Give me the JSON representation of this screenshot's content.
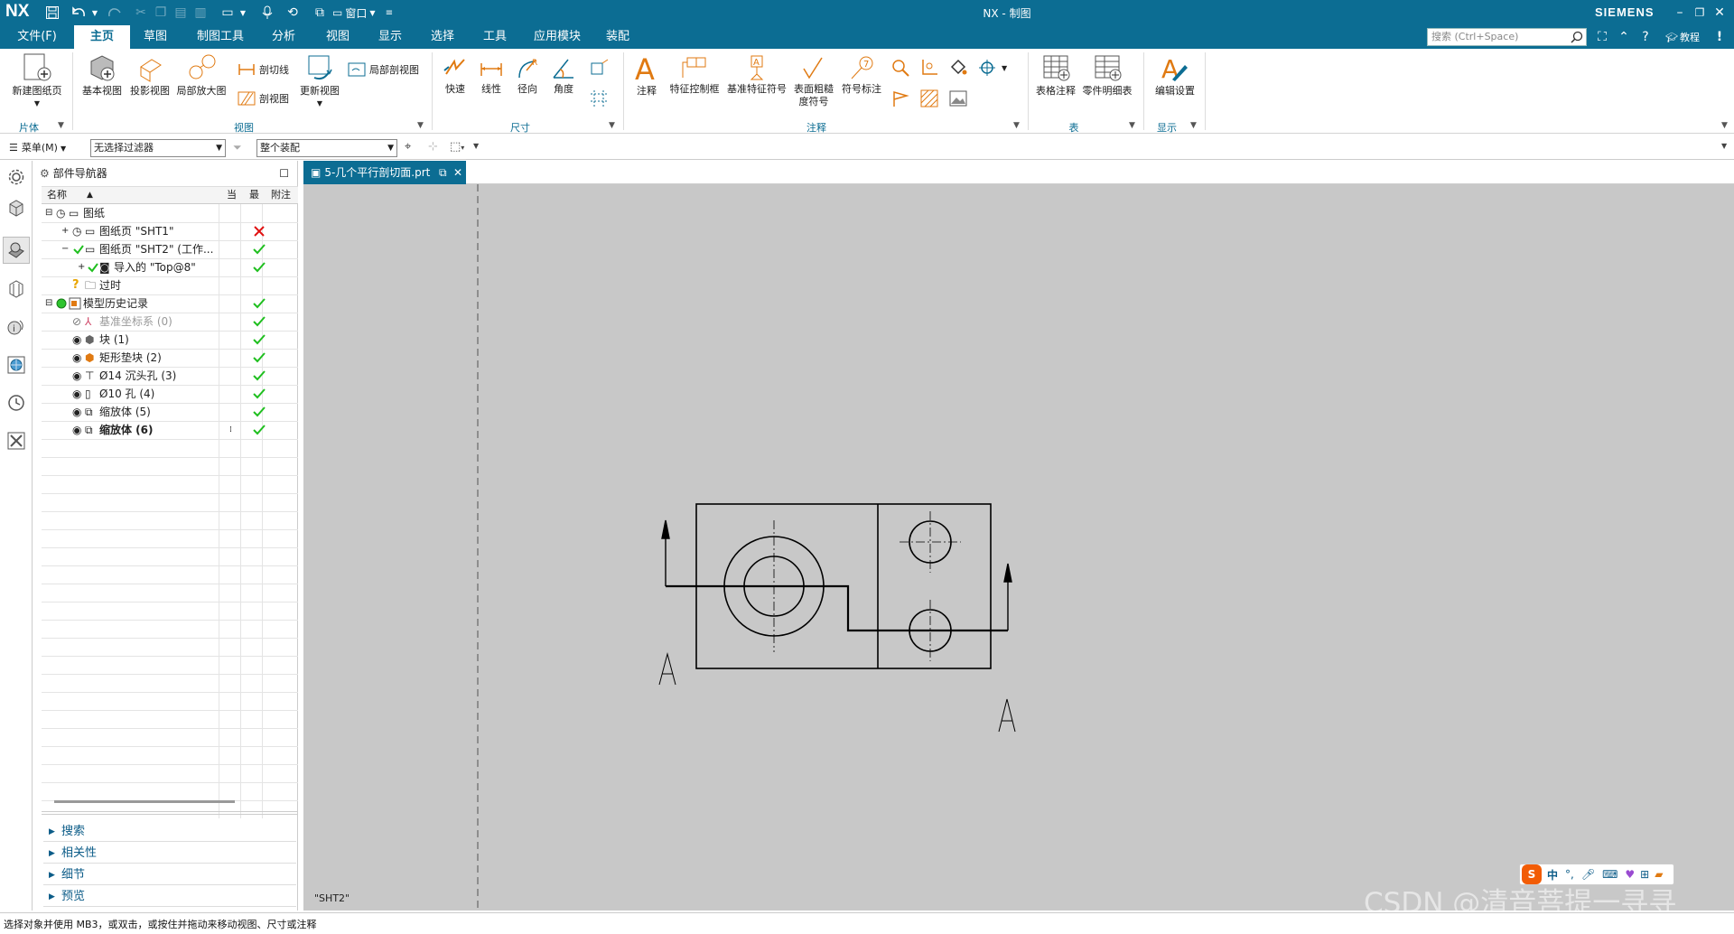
{
  "app": {
    "logo": "NX",
    "title": "NX - 制图",
    "brand": "SIEMENS",
    "window_menu": "窗口",
    "search_placeholder": "搜索 (Ctrl+Space)",
    "tutorial": "教程"
  },
  "tabs": [
    "文件(F)",
    "主页",
    "草图",
    "制图工具",
    "分析",
    "视图",
    "显示",
    "选择",
    "工具",
    "应用模块",
    "装配"
  ],
  "ribbon": {
    "sheet": {
      "new_sheet": "新建图纸页",
      "group": "片体"
    },
    "view": {
      "base": "基本视图",
      "projected": "投影视图",
      "detail": "局部放大图",
      "section_line": "剖切线",
      "section": "剖视图",
      "update": "更新视图",
      "break_out": "局部剖视图",
      "group": "视图"
    },
    "dimension": {
      "rapid": "快速",
      "linear": "线性",
      "radial": "径向",
      "angular": "角度",
      "group": "尺寸"
    },
    "annotation": {
      "note": "注释",
      "fcf": "特征控制框",
      "datum": "基准特征符号",
      "surface1": "表面粗糙",
      "surface2": "度符号",
      "symbol": "符号标注",
      "group": "注释"
    },
    "table": {
      "tabular": "表格注释",
      "parts_list": "零件明细表",
      "group": "表"
    },
    "display": {
      "edit_settings": "编辑设置",
      "group": "显示"
    }
  },
  "filterbar": {
    "menu": "菜单(M)",
    "filter": "无选择过滤器",
    "assembly": "整个装配"
  },
  "navigator": {
    "title": "部件导航器",
    "columns": {
      "name": "名称",
      "current": "当",
      "latest": "最",
      "attach": "附注"
    },
    "rows": [
      {
        "label": "图纸",
        "status": ""
      },
      {
        "label": "图纸页 \"SHT1\"",
        "status": "x"
      },
      {
        "label": "图纸页 \"SHT2\" (工作...",
        "status": "check"
      },
      {
        "label": "导入的 \"Top@8\"",
        "status": "check"
      },
      {
        "label": "过时",
        "status": ""
      },
      {
        "label": "模型历史记录",
        "status": "check"
      },
      {
        "label": "基准坐标系 (0)",
        "status": "check"
      },
      {
        "label": "块 (1)",
        "status": "check"
      },
      {
        "label": "矩形垫块 (2)",
        "status": "check"
      },
      {
        "label": "Ø14 沉头孔 (3)",
        "status": "check"
      },
      {
        "label": "Ø10 孔 (4)",
        "status": "check"
      },
      {
        "label": "缩放体 (5)",
        "status": "check"
      },
      {
        "label": "缩放体 (6)",
        "status": "check"
      }
    ],
    "sections": [
      "搜索",
      "相关性",
      "细节",
      "预览"
    ]
  },
  "document_tab": "5-几个平行剖切面.prt",
  "drawing": {
    "sheet_label": "\"SHT2\"",
    "section_labels": [
      "A",
      "A"
    ]
  },
  "status_text": "选择对象并使用 MB3，或双击，或按住并拖动来移动视图、尺寸或注释",
  "ime": {
    "lang": "中"
  },
  "watermark": "CSDN @清音菩提一寻寻",
  "colors": {
    "titlebar": "#0c6d93",
    "accent": "#e07a12",
    "canvas": "#c8c8c8",
    "check": "#1fbf1f",
    "cross": "#e01010"
  }
}
